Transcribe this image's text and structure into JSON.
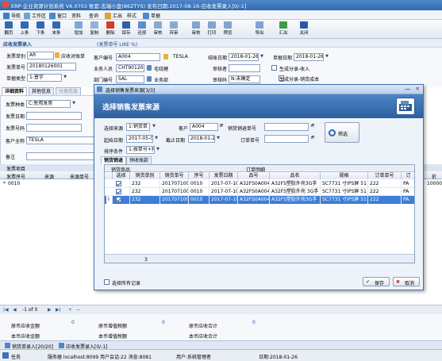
{
  "window": {
    "title": "ERP-企业资源计划系统 V6.0703 账套:志瑞小盘(86ZTYS) 发布日期:2017-08-16-应收发票录入[0/-1]"
  },
  "menu": {
    "items": [
      "导航",
      "工作区",
      "窗口",
      "资料",
      "查询",
      "汇出",
      "样式",
      "单据"
    ]
  },
  "toolbar": {
    "buttons": [
      "翻页",
      "上条",
      "下条",
      "末条",
      "增加",
      "复制",
      "删除",
      "保存",
      "还原",
      "审核",
      "弃审",
      "审核",
      "打印",
      "预览",
      "导出",
      "汇出",
      "关闭"
    ]
  },
  "doc": {
    "title": "应收发票录入",
    "hint": "(发票单号 LIKE %)"
  },
  "header": {
    "invoice_type_label": "发票单别",
    "invoice_type": "AR",
    "ar_ledger_label": "应收对账单",
    "invoice_no_label": "发票单号",
    "invoice_no": "20180126001",
    "doc_type_label": "单据类型",
    "doc_type": "1:普字",
    "customer_label": "客户编号",
    "customer_code": "A004",
    "customer_name": "TESLA",
    "salesman_label": "业务人员",
    "salesman_code": "CHT9012001",
    "salesman_name": "毛晓健",
    "dept_label": "部门编号",
    "dept_code": "SAL",
    "dept_name": "业务部",
    "settle_date_label": "结账日期",
    "settle_date": "2018-01-26",
    "doc_date_label": "单据日期",
    "doc_date": "2018-01-26",
    "reviewer_label": "审核者",
    "status_label": "审核码",
    "status": "N:未确定",
    "gen_income_label": "生成分录-收入",
    "gen_cost_label": "生成分录-销货成本"
  },
  "detail_tabs": [
    "详细资料",
    "其他信息",
    "分类信息"
  ],
  "detail": {
    "invoice_kind_label": "发票种类",
    "invoice_kind": "C:免用发票",
    "invoice_date_label": "发票日期",
    "invoice_code_label": "发票号码",
    "customer_full_label": "客户全称",
    "customer_full": "TESLA",
    "remark_label": "备注"
  },
  "grid": {
    "title": "发票项目",
    "columns": [
      "发票序号",
      "来源",
      "来源单号",
      "折"
    ],
    "row": {
      "seq": "0010",
      "amount": "10000"
    }
  },
  "nav": {
    "label": "-1 of 0"
  },
  "totals": {
    "labels": [
      "原币应收金额",
      "原币增值税额",
      "原币应收合计",
      "本币应收金额",
      "本币增值税额",
      "本币应收合计"
    ],
    "values": [
      "0",
      "0",
      "0",
      "",
      "",
      ""
    ]
  },
  "window_tabs": [
    "销货单录入[20/20]",
    "应收发票录入[0/-1]"
  ],
  "status": {
    "task": "任务",
    "server": "服务器 localhost:8099 用户会话:22 消息:8081",
    "user": "用户:系统管理者",
    "date": "日期:2018-01-26"
  },
  "dialog": {
    "window_title": "选择销售发票来源[3/3]",
    "header": "选择销售发票来源",
    "source_label": "选择来源",
    "source": "1:销货单",
    "customer_label": "客户",
    "customer": "A004",
    "sales_return_label": "销货销退单号",
    "start_date_label": "起始日期",
    "start_date": "2017-05-01",
    "end_date_label": "截止日期",
    "end_date": "2018-01-26",
    "order_no_label": "订单单号",
    "sort_label": "排序条件",
    "sort": "1:按单号+排",
    "filter_button": "筛选",
    "tabs": [
      "销货销退",
      "预收账款"
    ],
    "group_left": "销货商品",
    "group_right": "订单明细",
    "columns": [
      "选择",
      "销货单别",
      "销货单号",
      "序号",
      "发票日期",
      "品号",
      "品名",
      "规格",
      "订单单号",
      "订"
    ],
    "rows": [
      {
        "type": "232",
        "no": "201707100",
        "seq": "0010",
        "date": "2017-07-10",
        "item": "A32FS0A004S",
        "name": "A32FS塑胶外壳3G手",
        "spec": "SC7731 寸IPS屏 51",
        "order": "222",
        "ord": "PA"
      },
      {
        "type": "232",
        "no": "201707100",
        "seq": "0010",
        "date": "2017-07-10",
        "item": "A32FS0A004S",
        "name": "A32FS塑胶外壳 3G手",
        "spec": "SC7731 寸IPS屏 51",
        "order": "222",
        "ord": "PA"
      },
      {
        "type": "232",
        "no": "201707100",
        "seq": "0010",
        "date": "2017-07-10",
        "item": "A32FS0A004S",
        "name": "A32FS塑胶外壳3G手",
        "spec": "SC7731 寸IPS屏 51",
        "order": "222",
        "ord": "PA"
      }
    ],
    "footer_count": "3",
    "select_all_label": "选择所有记录",
    "save_button": "保存",
    "cancel_button": "取消"
  }
}
